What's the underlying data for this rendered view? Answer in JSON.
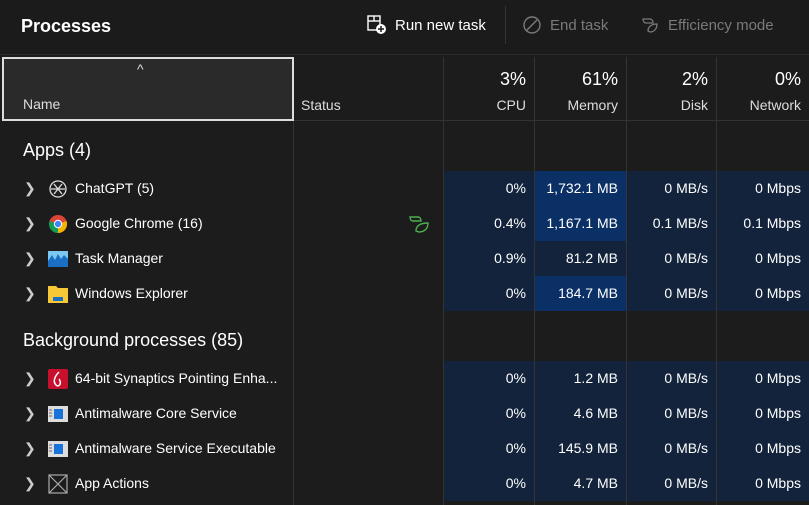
{
  "toolbar": {
    "title": "Processes",
    "run_new_task": "Run new task",
    "end_task": "End task",
    "efficiency_mode": "Efficiency mode"
  },
  "columns": {
    "name": "Name",
    "status": "Status",
    "cpu": {
      "label": "CPU",
      "pct": "3%"
    },
    "memory": {
      "label": "Memory",
      "pct": "61%"
    },
    "disk": {
      "label": "Disk",
      "pct": "2%"
    },
    "network": {
      "label": "Network",
      "pct": "0%"
    }
  },
  "groups": {
    "apps": "Apps (4)",
    "background": "Background processes (85)"
  },
  "apps": [
    {
      "name": "ChatGPT (5)",
      "icon": "chatgpt-icon",
      "cpu": "0%",
      "memory": "1,732.1 MB",
      "disk": "0 MB/s",
      "network": "0 Mbps"
    },
    {
      "name": "Google Chrome (16)",
      "icon": "chrome-icon",
      "cpu": "0.4%",
      "memory": "1,167.1 MB",
      "disk": "0.1 MB/s",
      "network": "0.1 Mbps",
      "status": "efficiency-leaf-icon"
    },
    {
      "name": "Task Manager",
      "icon": "task-manager-icon",
      "cpu": "0.9%",
      "memory": "81.2 MB",
      "disk": "0 MB/s",
      "network": "0 Mbps"
    },
    {
      "name": "Windows Explorer",
      "icon": "folder-icon",
      "cpu": "0%",
      "memory": "184.7 MB",
      "disk": "0 MB/s",
      "network": "0 Mbps"
    }
  ],
  "background": [
    {
      "name": "64-bit Synaptics Pointing Enha...",
      "icon": "synaptics-icon",
      "cpu": "0%",
      "memory": "1.2 MB",
      "disk": "0 MB/s",
      "network": "0 Mbps"
    },
    {
      "name": "Antimalware Core Service",
      "icon": "service-window-icon",
      "cpu": "0%",
      "memory": "4.6 MB",
      "disk": "0 MB/s",
      "network": "0 Mbps"
    },
    {
      "name": "Antimalware Service Executable",
      "icon": "service-window-icon",
      "cpu": "0%",
      "memory": "145.9 MB",
      "disk": "0 MB/s",
      "network": "0 Mbps"
    },
    {
      "name": "App Actions",
      "icon": "placeholder-icon",
      "cpu": "0%",
      "memory": "4.7 MB",
      "disk": "0 MB/s",
      "network": "0 Mbps"
    }
  ]
}
